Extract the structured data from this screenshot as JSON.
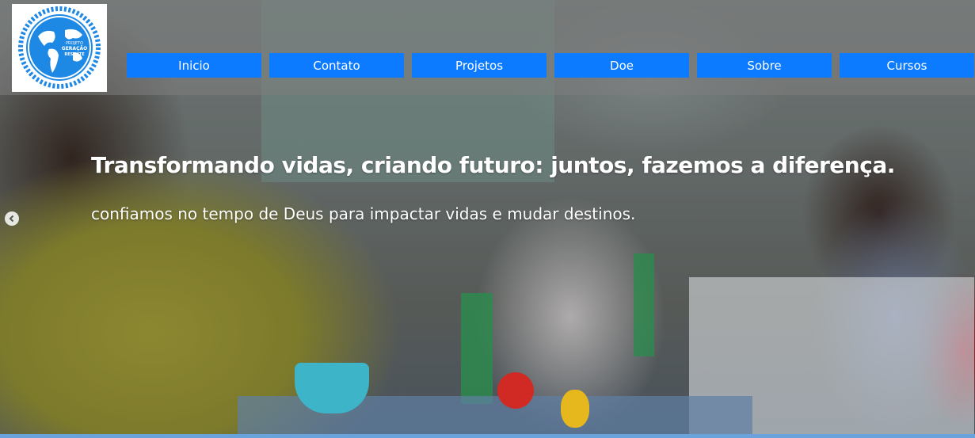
{
  "logo": {
    "name": "logo-icon",
    "text_line1": "PROJETO",
    "text_line2": "GERAÇÃO",
    "text_line3": "RESGATE",
    "color": "#1e88e5"
  },
  "nav": {
    "items": [
      {
        "label": "Inicio"
      },
      {
        "label": "Contato"
      },
      {
        "label": "Projetos"
      },
      {
        "label": "Doe"
      },
      {
        "label": "Sobre"
      },
      {
        "label": "Cursos"
      }
    ],
    "color": "#0d7bff"
  },
  "hero": {
    "headline": "Transformando vidas, criando futuro: juntos, fazemos a diferença.",
    "subline": "confiamos no tempo de Deus para impactar vidas e mudar destinos."
  },
  "slider": {
    "prev_icon": "chevron-left-icon"
  }
}
